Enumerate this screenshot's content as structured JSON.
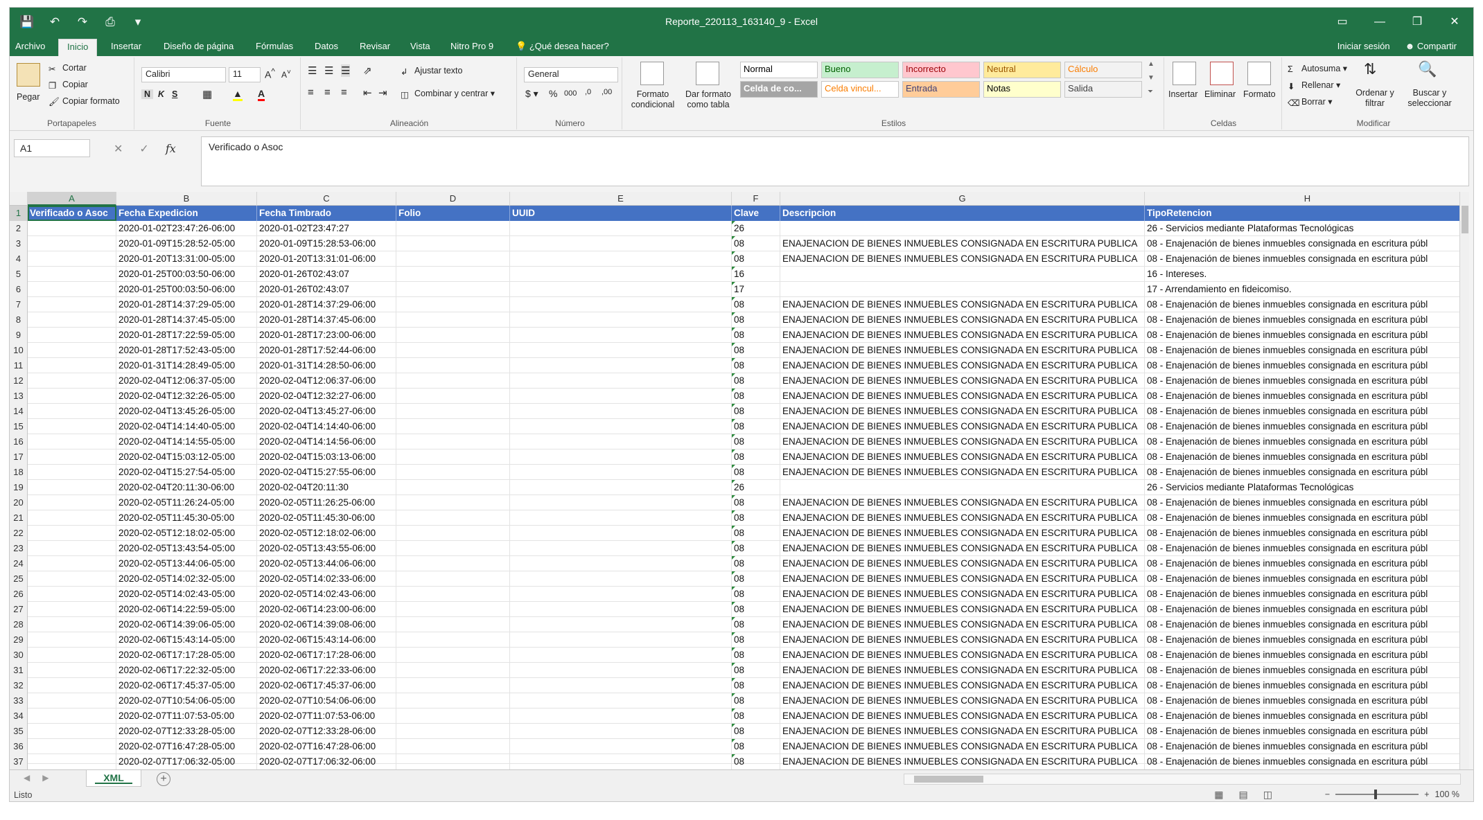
{
  "window": {
    "title": "Reporte_220113_163140_9 - Excel",
    "controls": [
      "▭",
      "—",
      "❐",
      "✕"
    ]
  },
  "tabs": [
    "Archivo",
    "Inicio",
    "Insertar",
    "Diseño de página",
    "Fórmulas",
    "Datos",
    "Revisar",
    "Vista",
    "Nitro Pro 9"
  ],
  "tell_me": "¿Qué desea hacer?",
  "account": {
    "signin": "Iniciar sesión",
    "share": "Compartir"
  },
  "ribbon": {
    "clipboard": {
      "label": "Portapapeles",
      "paste": "Pegar",
      "cut": "Cortar",
      "copy": "Copiar",
      "format_painter": "Copiar formato"
    },
    "font": {
      "label": "Fuente",
      "name": "Calibri",
      "size": "11"
    },
    "alignment": {
      "label": "Alineación",
      "wrap": "Ajustar texto",
      "merge": "Combinar y centrar"
    },
    "number": {
      "label": "Número",
      "format": "General"
    },
    "styles": {
      "label": "Estilos",
      "conditional": "Formato condicional",
      "as_table": "Dar formato como tabla",
      "cells": [
        {
          "text": "Normal",
          "bg": "#ffffff",
          "fg": "#000000"
        },
        {
          "text": "Bueno",
          "bg": "#c6efce",
          "fg": "#006100"
        },
        {
          "text": "Incorrecto",
          "bg": "#ffc7ce",
          "fg": "#9c0006"
        },
        {
          "text": "Neutral",
          "bg": "#ffeb9c",
          "fg": "#9c5700"
        },
        {
          "text": "Cálculo",
          "bg": "#f2f2f2",
          "fg": "#fa7d00"
        },
        {
          "text": "Celda de co...",
          "bg": "#a5a5a5",
          "fg": "#ffffff"
        },
        {
          "text": "Celda vincul...",
          "bg": "#ffffff",
          "fg": "#fa7d00"
        },
        {
          "text": "Entrada",
          "bg": "#ffcc99",
          "fg": "#3f3f76"
        },
        {
          "text": "Notas",
          "bg": "#ffffcc",
          "fg": "#000000"
        },
        {
          "text": "Salida",
          "bg": "#f2f2f2",
          "fg": "#3f3f3f"
        }
      ]
    },
    "cells": {
      "label": "Celdas",
      "insert": "Insertar",
      "delete": "Eliminar",
      "format": "Formato"
    },
    "editing": {
      "label": "Modificar",
      "autosum": "Autosuma",
      "fill": "Rellenar",
      "clear": "Borrar",
      "sort": "Ordenar y filtrar",
      "find": "Buscar y seleccionar"
    }
  },
  "formula_bar": {
    "name_box": "A1",
    "content": "Verificado o Asoc"
  },
  "columns": [
    "A",
    "B",
    "C",
    "D",
    "E",
    "F",
    "G",
    "H"
  ],
  "table": {
    "headers": [
      "Verificado o Asoc",
      "Fecha Expedicion",
      "Fecha Timbrado",
      "Folio",
      "UUID",
      "Clave",
      "Descripcion",
      "TipoRetencion"
    ],
    "rows": [
      [
        "",
        "2020-01-02T23:47:26-06:00",
        "2020-01-02T23:47:27",
        "",
        "",
        "26",
        "",
        "26 - Servicios mediante Plataformas Tecnológicas"
      ],
      [
        "",
        "2020-01-09T15:28:52-05:00",
        "2020-01-09T15:28:53-06:00",
        "",
        "",
        "08",
        "ENAJENACION DE BIENES INMUEBLES CONSIGNADA EN ESCRITURA PUBLICA",
        "08 - Enajenación de bienes inmuebles consignada en escritura públ"
      ],
      [
        "",
        "2020-01-20T13:31:00-05:00",
        "2020-01-20T13:31:01-06:00",
        "",
        "",
        "08",
        "ENAJENACION DE BIENES INMUEBLES CONSIGNADA EN ESCRITURA PUBLICA",
        "08 - Enajenación de bienes inmuebles consignada en escritura públ"
      ],
      [
        "",
        "2020-01-25T00:03:50-06:00",
        "2020-01-26T02:43:07",
        "",
        "",
        "16",
        "",
        "16 - Intereses."
      ],
      [
        "",
        "2020-01-25T00:03:50-06:00",
        "2020-01-26T02:43:07",
        "",
        "",
        "17",
        "",
        "17 - Arrendamiento en fideicomiso."
      ],
      [
        "",
        "2020-01-28T14:37:29-05:00",
        "2020-01-28T14:37:29-06:00",
        "",
        "",
        "08",
        "ENAJENACION DE BIENES INMUEBLES CONSIGNADA EN ESCRITURA PUBLICA",
        "08 - Enajenación de bienes inmuebles consignada en escritura públ"
      ],
      [
        "",
        "2020-01-28T14:37:45-05:00",
        "2020-01-28T14:37:45-06:00",
        "",
        "",
        "08",
        "ENAJENACION DE BIENES INMUEBLES CONSIGNADA EN ESCRITURA PUBLICA",
        "08 - Enajenación de bienes inmuebles consignada en escritura públ"
      ],
      [
        "",
        "2020-01-28T17:22:59-05:00",
        "2020-01-28T17:23:00-06:00",
        "",
        "",
        "08",
        "ENAJENACION DE BIENES INMUEBLES CONSIGNADA EN ESCRITURA PUBLICA",
        "08 - Enajenación de bienes inmuebles consignada en escritura públ"
      ],
      [
        "",
        "2020-01-28T17:52:43-05:00",
        "2020-01-28T17:52:44-06:00",
        "",
        "",
        "08",
        "ENAJENACION DE BIENES INMUEBLES CONSIGNADA EN ESCRITURA PUBLICA",
        "08 - Enajenación de bienes inmuebles consignada en escritura públ"
      ],
      [
        "",
        "2020-01-31T14:28:49-05:00",
        "2020-01-31T14:28:50-06:00",
        "",
        "",
        "08",
        "ENAJENACION DE BIENES INMUEBLES CONSIGNADA EN ESCRITURA PUBLICA",
        "08 - Enajenación de bienes inmuebles consignada en escritura públ"
      ],
      [
        "",
        "2020-02-04T12:06:37-05:00",
        "2020-02-04T12:06:37-06:00",
        "",
        "",
        "08",
        "ENAJENACION DE BIENES INMUEBLES CONSIGNADA EN ESCRITURA PUBLICA",
        "08 - Enajenación de bienes inmuebles consignada en escritura públ"
      ],
      [
        "",
        "2020-02-04T12:32:26-05:00",
        "2020-02-04T12:32:27-06:00",
        "",
        "",
        "08",
        "ENAJENACION DE BIENES INMUEBLES CONSIGNADA EN ESCRITURA PUBLICA",
        "08 - Enajenación de bienes inmuebles consignada en escritura públ"
      ],
      [
        "",
        "2020-02-04T13:45:26-05:00",
        "2020-02-04T13:45:27-06:00",
        "",
        "",
        "08",
        "ENAJENACION DE BIENES INMUEBLES CONSIGNADA EN ESCRITURA PUBLICA",
        "08 - Enajenación de bienes inmuebles consignada en escritura públ"
      ],
      [
        "",
        "2020-02-04T14:14:40-05:00",
        "2020-02-04T14:14:40-06:00",
        "",
        "",
        "08",
        "ENAJENACION DE BIENES INMUEBLES CONSIGNADA EN ESCRITURA PUBLICA",
        "08 - Enajenación de bienes inmuebles consignada en escritura públ"
      ],
      [
        "",
        "2020-02-04T14:14:55-05:00",
        "2020-02-04T14:14:56-06:00",
        "",
        "",
        "08",
        "ENAJENACION DE BIENES INMUEBLES CONSIGNADA EN ESCRITURA PUBLICA",
        "08 - Enajenación de bienes inmuebles consignada en escritura públ"
      ],
      [
        "",
        "2020-02-04T15:03:12-05:00",
        "2020-02-04T15:03:13-06:00",
        "",
        "",
        "08",
        "ENAJENACION DE BIENES INMUEBLES CONSIGNADA EN ESCRITURA PUBLICA",
        "08 - Enajenación de bienes inmuebles consignada en escritura públ"
      ],
      [
        "",
        "2020-02-04T15:27:54-05:00",
        "2020-02-04T15:27:55-06:00",
        "",
        "",
        "08",
        "ENAJENACION DE BIENES INMUEBLES CONSIGNADA EN ESCRITURA PUBLICA",
        "08 - Enajenación de bienes inmuebles consignada en escritura públ"
      ],
      [
        "",
        "2020-02-04T20:11:30-06:00",
        "2020-02-04T20:11:30",
        "",
        "",
        "26",
        "",
        "26 - Servicios mediante Plataformas Tecnológicas"
      ],
      [
        "",
        "2020-02-05T11:26:24-05:00",
        "2020-02-05T11:26:25-06:00",
        "",
        "",
        "08",
        "ENAJENACION DE BIENES INMUEBLES CONSIGNADA EN ESCRITURA PUBLICA",
        "08 - Enajenación de bienes inmuebles consignada en escritura públ"
      ],
      [
        "",
        "2020-02-05T11:45:30-05:00",
        "2020-02-05T11:45:30-06:00",
        "",
        "",
        "08",
        "ENAJENACION DE BIENES INMUEBLES CONSIGNADA EN ESCRITURA PUBLICA",
        "08 - Enajenación de bienes inmuebles consignada en escritura públ"
      ],
      [
        "",
        "2020-02-05T12:18:02-05:00",
        "2020-02-05T12:18:02-06:00",
        "",
        "",
        "08",
        "ENAJENACION DE BIENES INMUEBLES CONSIGNADA EN ESCRITURA PUBLICA",
        "08 - Enajenación de bienes inmuebles consignada en escritura públ"
      ],
      [
        "",
        "2020-02-05T13:43:54-05:00",
        "2020-02-05T13:43:55-06:00",
        "",
        "",
        "08",
        "ENAJENACION DE BIENES INMUEBLES CONSIGNADA EN ESCRITURA PUBLICA",
        "08 - Enajenación de bienes inmuebles consignada en escritura públ"
      ],
      [
        "",
        "2020-02-05T13:44:06-05:00",
        "2020-02-05T13:44:06-06:00",
        "",
        "",
        "08",
        "ENAJENACION DE BIENES INMUEBLES CONSIGNADA EN ESCRITURA PUBLICA",
        "08 - Enajenación de bienes inmuebles consignada en escritura públ"
      ],
      [
        "",
        "2020-02-05T14:02:32-05:00",
        "2020-02-05T14:02:33-06:00",
        "",
        "",
        "08",
        "ENAJENACION DE BIENES INMUEBLES CONSIGNADA EN ESCRITURA PUBLICA",
        "08 - Enajenación de bienes inmuebles consignada en escritura públ"
      ],
      [
        "",
        "2020-02-05T14:02:43-05:00",
        "2020-02-05T14:02:43-06:00",
        "",
        "",
        "08",
        "ENAJENACION DE BIENES INMUEBLES CONSIGNADA EN ESCRITURA PUBLICA",
        "08 - Enajenación de bienes inmuebles consignada en escritura públ"
      ],
      [
        "",
        "2020-02-06T14:22:59-05:00",
        "2020-02-06T14:23:00-06:00",
        "",
        "",
        "08",
        "ENAJENACION DE BIENES INMUEBLES CONSIGNADA EN ESCRITURA PUBLICA",
        "08 - Enajenación de bienes inmuebles consignada en escritura públ"
      ],
      [
        "",
        "2020-02-06T14:39:06-05:00",
        "2020-02-06T14:39:08-06:00",
        "",
        "",
        "08",
        "ENAJENACION DE BIENES INMUEBLES CONSIGNADA EN ESCRITURA PUBLICA",
        "08 - Enajenación de bienes inmuebles consignada en escritura públ"
      ],
      [
        "",
        "2020-02-06T15:43:14-05:00",
        "2020-02-06T15:43:14-06:00",
        "",
        "",
        "08",
        "ENAJENACION DE BIENES INMUEBLES CONSIGNADA EN ESCRITURA PUBLICA",
        "08 - Enajenación de bienes inmuebles consignada en escritura públ"
      ],
      [
        "",
        "2020-02-06T17:17:28-05:00",
        "2020-02-06T17:17:28-06:00",
        "",
        "",
        "08",
        "ENAJENACION DE BIENES INMUEBLES CONSIGNADA EN ESCRITURA PUBLICA",
        "08 - Enajenación de bienes inmuebles consignada en escritura públ"
      ],
      [
        "",
        "2020-02-06T17:22:32-05:00",
        "2020-02-06T17:22:33-06:00",
        "",
        "",
        "08",
        "ENAJENACION DE BIENES INMUEBLES CONSIGNADA EN ESCRITURA PUBLICA",
        "08 - Enajenación de bienes inmuebles consignada en escritura públ"
      ],
      [
        "",
        "2020-02-06T17:45:37-05:00",
        "2020-02-06T17:45:37-06:00",
        "",
        "",
        "08",
        "ENAJENACION DE BIENES INMUEBLES CONSIGNADA EN ESCRITURA PUBLICA",
        "08 - Enajenación de bienes inmuebles consignada en escritura públ"
      ],
      [
        "",
        "2020-02-07T10:54:06-05:00",
        "2020-02-07T10:54:06-06:00",
        "",
        "",
        "08",
        "ENAJENACION DE BIENES INMUEBLES CONSIGNADA EN ESCRITURA PUBLICA",
        "08 - Enajenación de bienes inmuebles consignada en escritura públ"
      ],
      [
        "",
        "2020-02-07T11:07:53-05:00",
        "2020-02-07T11:07:53-06:00",
        "",
        "",
        "08",
        "ENAJENACION DE BIENES INMUEBLES CONSIGNADA EN ESCRITURA PUBLICA",
        "08 - Enajenación de bienes inmuebles consignada en escritura públ"
      ],
      [
        "",
        "2020-02-07T12:33:28-05:00",
        "2020-02-07T12:33:28-06:00",
        "",
        "",
        "08",
        "ENAJENACION DE BIENES INMUEBLES CONSIGNADA EN ESCRITURA PUBLICA",
        "08 - Enajenación de bienes inmuebles consignada en escritura públ"
      ],
      [
        "",
        "2020-02-07T16:47:28-05:00",
        "2020-02-07T16:47:28-06:00",
        "",
        "",
        "08",
        "ENAJENACION DE BIENES INMUEBLES CONSIGNADA EN ESCRITURA PUBLICA",
        "08 - Enajenación de bienes inmuebles consignada en escritura públ"
      ],
      [
        "",
        "2020-02-07T17:06:32-05:00",
        "2020-02-07T17:06:32-06:00",
        "",
        "",
        "08",
        "ENAJENACION DE BIENES INMUEBLES CONSIGNADA EN ESCRITURA PUBLICA",
        "08 - Enajenación de bienes inmuebles consignada en escritura públ"
      ]
    ]
  },
  "sheet": {
    "tab": "XML"
  },
  "status": {
    "ready": "Listo",
    "zoom": "100 %"
  }
}
